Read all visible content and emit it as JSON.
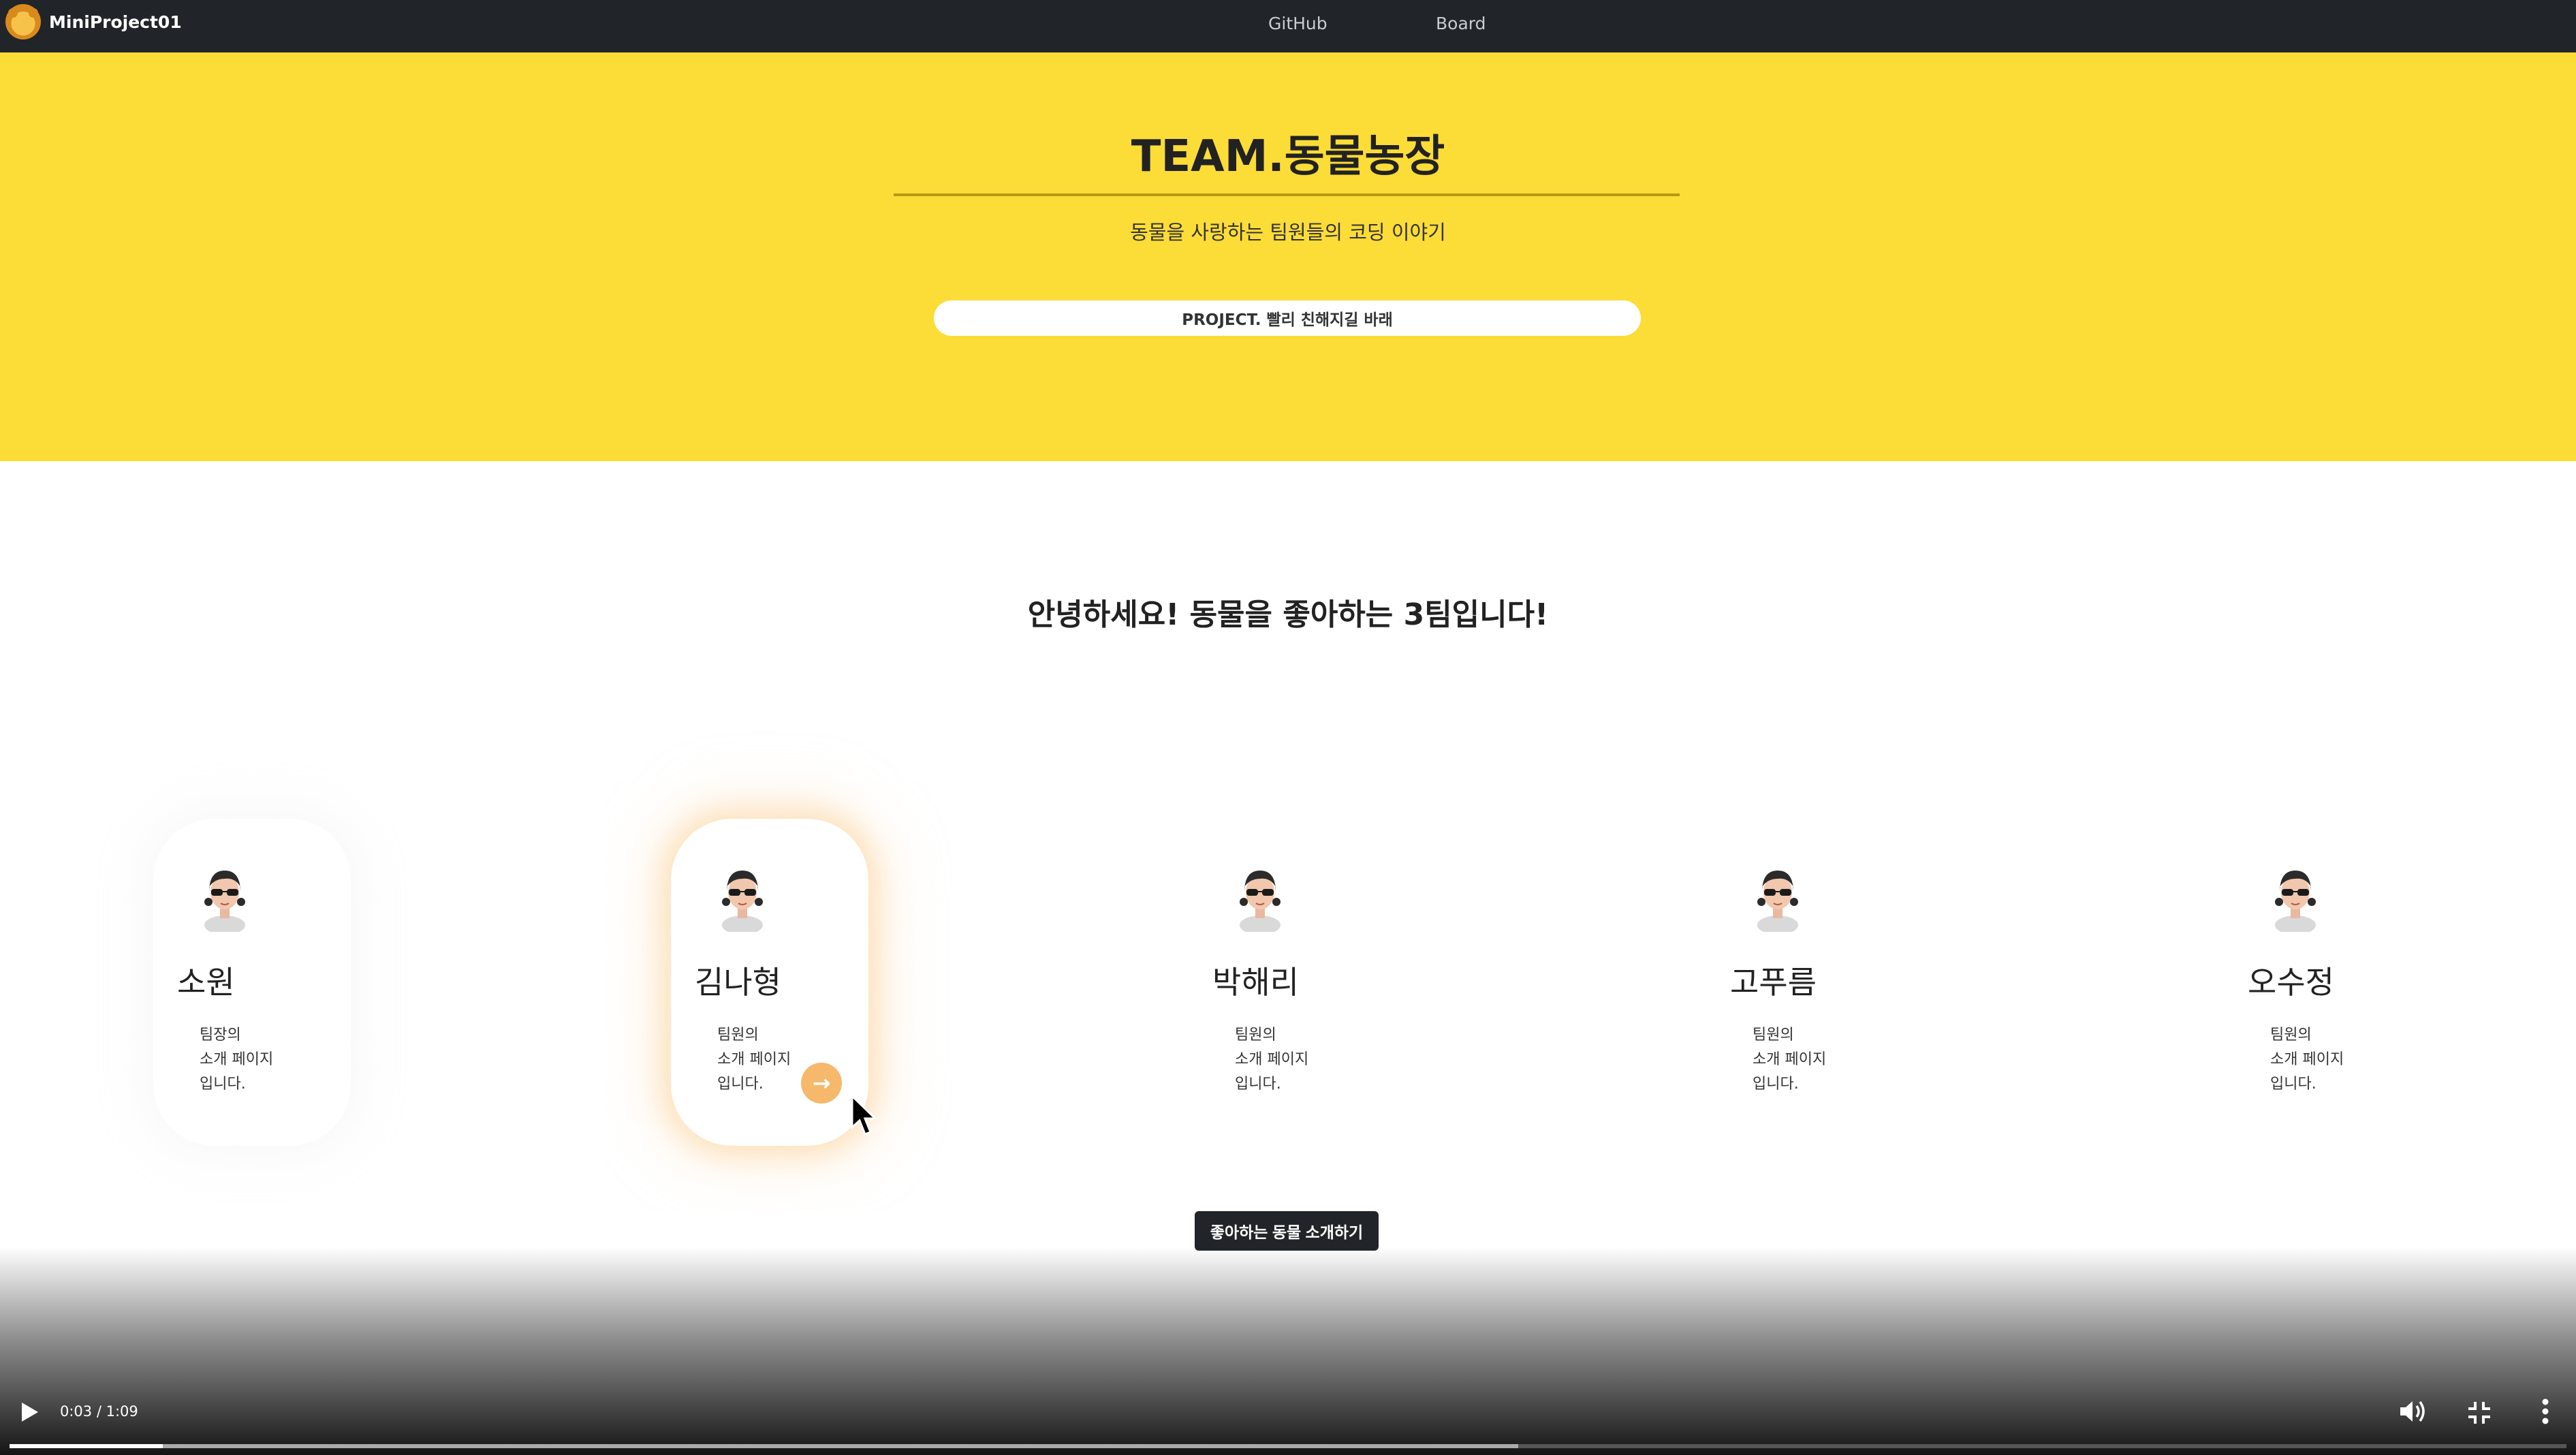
{
  "navbar": {
    "brand": "MiniProject01",
    "links": [
      "GitHub",
      "Board"
    ]
  },
  "hero": {
    "title": "TEAM.동물농장",
    "subtitle": "동물을 사랑하는 팀원들의 코딩 이야기",
    "project_label": "PROJECT. 빨리 친해지길 바래"
  },
  "greeting": "안녕하세요! 동물을 좋아하는 3팀입니다!",
  "members": [
    {
      "name": "소원",
      "desc": [
        "팀장의",
        "소개 페이지",
        "입니다."
      ]
    },
    {
      "name": "김나형",
      "desc": [
        "팀원의",
        "소개 페이지",
        "입니다."
      ]
    },
    {
      "name": "박해리",
      "desc": [
        "팀원의",
        "소개 페이지",
        "입니다."
      ]
    },
    {
      "name": "고푸름",
      "desc": [
        "팀원의",
        "소개 페이지",
        "입니다."
      ]
    },
    {
      "name": "오수정",
      "desc": [
        "팀원의",
        "소개 페이지",
        "입니다."
      ]
    }
  ],
  "cta_label": "좋아하는 동물 소개하기",
  "video": {
    "time": "0:03 / 1:09",
    "played_fraction": 0.06,
    "buffered_fraction": 0.59
  },
  "colors": {
    "navbar": "#212529",
    "hero": "#fcdc37",
    "accent_orange": "#f6b86b"
  }
}
